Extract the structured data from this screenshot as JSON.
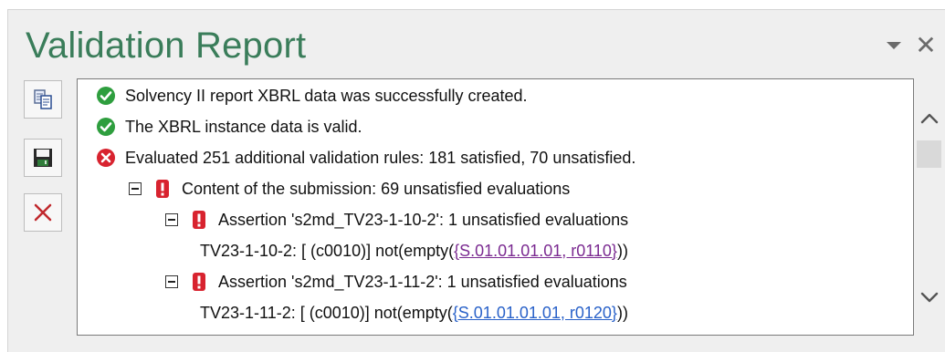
{
  "header": {
    "title": "Validation Report"
  },
  "toolbar": [
    "copy-icon",
    "save-icon",
    "delete-icon"
  ],
  "messages": [
    {
      "text": "Solvency II report XBRL data was successfully created.",
      "status": "success"
    },
    {
      "text": "The XBRL instance data is valid.",
      "status": "success"
    },
    {
      "text": "Evaluated 251 additional validation rules: 181 satisfied, 70 unsatisfied.",
      "status": "error"
    },
    {
      "text": "Content of the submission: 69 unsatisfied evaluations",
      "status": "warning"
    },
    {
      "text": "Assertion 's2md_TV23-1-10-2': 1 unsatisfied evaluations",
      "status": "warning"
    },
    {
      "prefix": "TV23-1-10-2: [ (c0010)] not(empty(",
      "link": "{S.01.01.01.01, r0110}",
      "suffix": "))"
    },
    {
      "text": "Assertion 's2md_TV23-1-11-2': 1 unsatisfied evaluations",
      "status": "warning"
    },
    {
      "prefix": "TV23-1-11-2: [ (c0010)] not(empty(",
      "link": "{S.01.01.01.01, r0120}",
      "suffix": "))"
    }
  ],
  "colors": {
    "title": "#3a7d5a",
    "success": "#2e9e3e",
    "error": "#d8232f",
    "visited_link": "#7b2b91",
    "link": "#2a62c9"
  }
}
